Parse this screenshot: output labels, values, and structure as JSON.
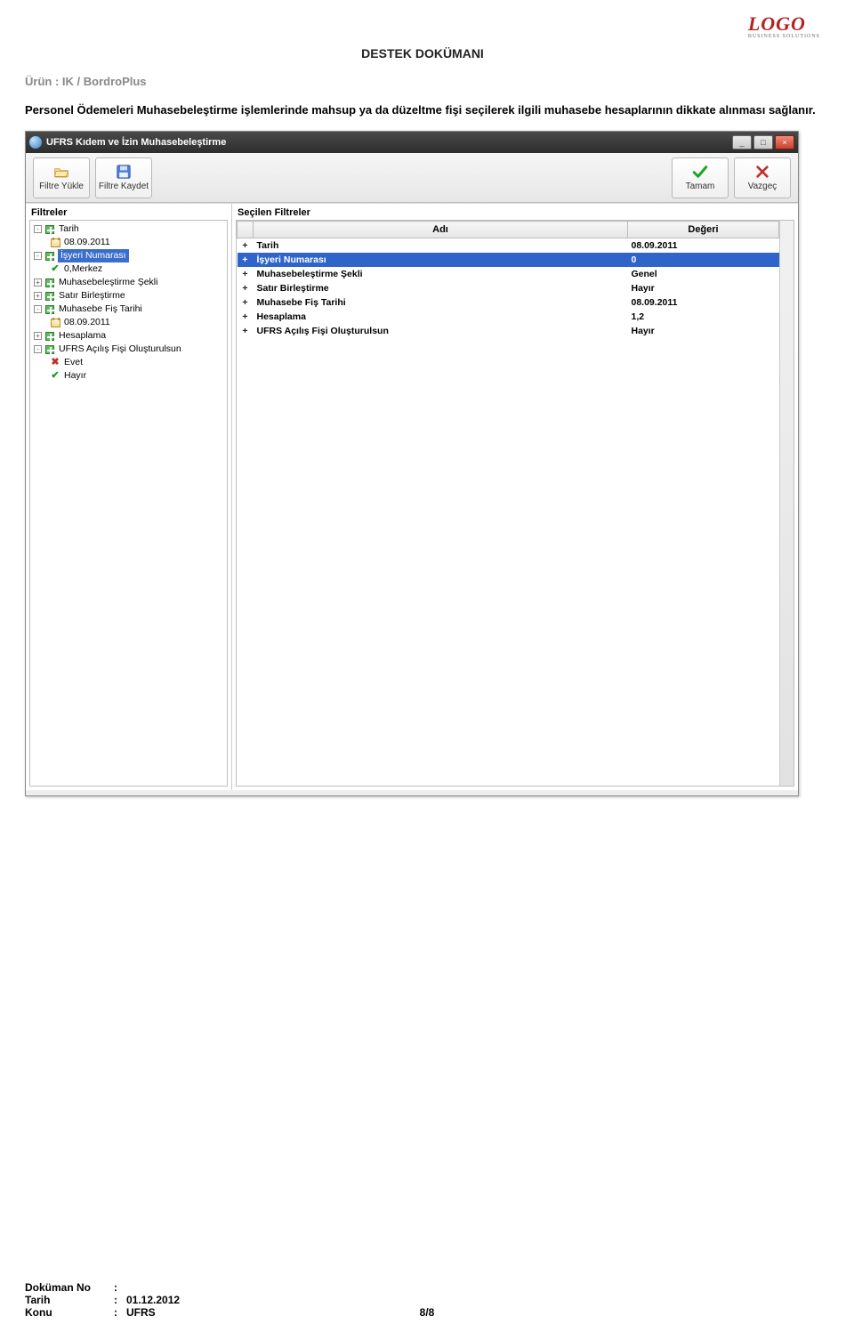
{
  "doc": {
    "header": "DESTEK DOKÜMANI",
    "product_label": "Ürün",
    "product_sep": ":  ",
    "product_value": "IK / BordroPlus",
    "body": "Personel Ödemeleri Muhasebeleştirme işlemlerinde mahsup ya da düzeltme fişi seçilerek ilgili muhasebe hesaplarının dikkate alınması sağlanır.",
    "logo": "LOGO",
    "logo_sub": "BUSINESS SOLUTIONS"
  },
  "window": {
    "title": "UFRS Kıdem ve İzin Muhasebeleştirme",
    "minimize": "_",
    "maximize": "□",
    "close": "×"
  },
  "toolbar": {
    "filtre_yukle": "Filtre Yükle",
    "filtre_kaydet": "Filtre Kaydet",
    "tamam": "Tamam",
    "vazgec": "Vazgeç"
  },
  "panes": {
    "left_title": "Filtreler",
    "right_title": "Seçilen Filtreler"
  },
  "tree": {
    "n0": {
      "label": "Tarih",
      "toggle": "-"
    },
    "n0a": {
      "label": "08.09.2011"
    },
    "n1": {
      "label": "İşyeri Numarası",
      "toggle": "-"
    },
    "n1a": {
      "label": "0,Merkez"
    },
    "n2": {
      "label": "Muhasebeleştirme Şekli",
      "toggle": "+"
    },
    "n3": {
      "label": "Satır Birleştirme",
      "toggle": "+"
    },
    "n4": {
      "label": "Muhasebe Fiş Tarihi",
      "toggle": "-"
    },
    "n4a": {
      "label": "08.09.2011"
    },
    "n5": {
      "label": "Hesaplama",
      "toggle": "+"
    },
    "n6": {
      "label": "UFRS Açılış Fişi Oluşturulsun",
      "toggle": "-"
    },
    "n6a": {
      "label": "Evet"
    },
    "n6b": {
      "label": "Hayır"
    }
  },
  "grid": {
    "headers": {
      "name": "Adı",
      "value": "Değeri"
    },
    "rows": [
      {
        "plus": "+",
        "name": "Tarih",
        "value": "08.09.2011",
        "selected": false
      },
      {
        "plus": "+",
        "name": "İşyeri Numarası",
        "value": "0",
        "selected": true
      },
      {
        "plus": "+",
        "name": "Muhasebeleştirme Şekli",
        "value": "Genel",
        "selected": false
      },
      {
        "plus": "+",
        "name": "Satır Birleştirme",
        "value": "Hayır",
        "selected": false
      },
      {
        "plus": "+",
        "name": "Muhasebe Fiş Tarihi",
        "value": "08.09.2011",
        "selected": false
      },
      {
        "plus": "+",
        "name": "Hesaplama",
        "value": "1,2",
        "selected": false
      },
      {
        "plus": "+",
        "name": "UFRS Açılış Fişi Oluşturulsun",
        "value": "Hayır",
        "selected": false
      }
    ]
  },
  "footer": {
    "dokuman_no_k": "Doküman No",
    "dokuman_no_v": "",
    "tarih_k": "Tarih",
    "tarih_v": "01.12.2012",
    "konu_k": "Konu",
    "konu_v": "UFRS",
    "page": "8/8",
    "colon": ":"
  }
}
